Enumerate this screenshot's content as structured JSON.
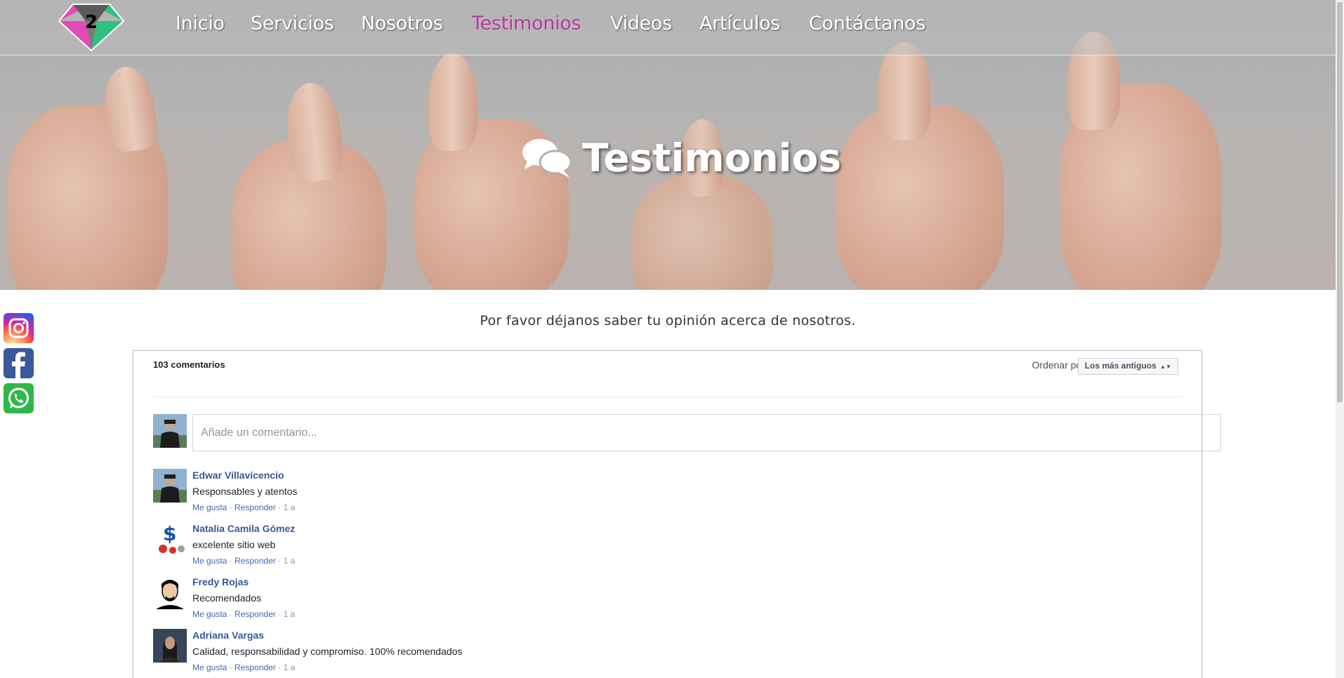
{
  "nav": {
    "logo_number": "2",
    "items": [
      {
        "label": "Inicio"
      },
      {
        "label": "Servicios"
      },
      {
        "label": "Nosotros"
      },
      {
        "label": "Testimonios"
      },
      {
        "label": "Videos"
      },
      {
        "label": "Artículos"
      },
      {
        "label": "Contáctanos"
      }
    ],
    "active": "Testimonios"
  },
  "hero": {
    "title": "Testimonios",
    "icon": "comments-icon"
  },
  "social": [
    "instagram-icon",
    "facebook-icon",
    "whatsapp-icon"
  ],
  "intro": "Por favor déjanos saber tu opinión acerca de nosotros.",
  "comments_plugin": {
    "count": "103 comentarios",
    "order_label": "Ordenar por",
    "order_value": "Los más antiguos",
    "input_placeholder": "Añade un comentario...",
    "like": "Me gusta",
    "reply": "Responder",
    "sep": "·",
    "comments": [
      {
        "author": "Edwar Villavicencio",
        "text": "Responsables y atentos",
        "time": "1 a"
      },
      {
        "author": "Natalia Camila Gómez",
        "text": "excelente sitio web",
        "time": "1 a"
      },
      {
        "author": "Fredy Rojas",
        "text": "Recomendados",
        "time": "1 a"
      },
      {
        "author": "Adriana Vargas",
        "text": "Calidad, responsabilidad y compromiso. 100% recomendados",
        "time": "1 a"
      }
    ]
  },
  "colors": {
    "accent": "#b23a9e",
    "link": "#365899",
    "logo_pink": "#e04bb8",
    "logo_green": "#2ec27e"
  }
}
